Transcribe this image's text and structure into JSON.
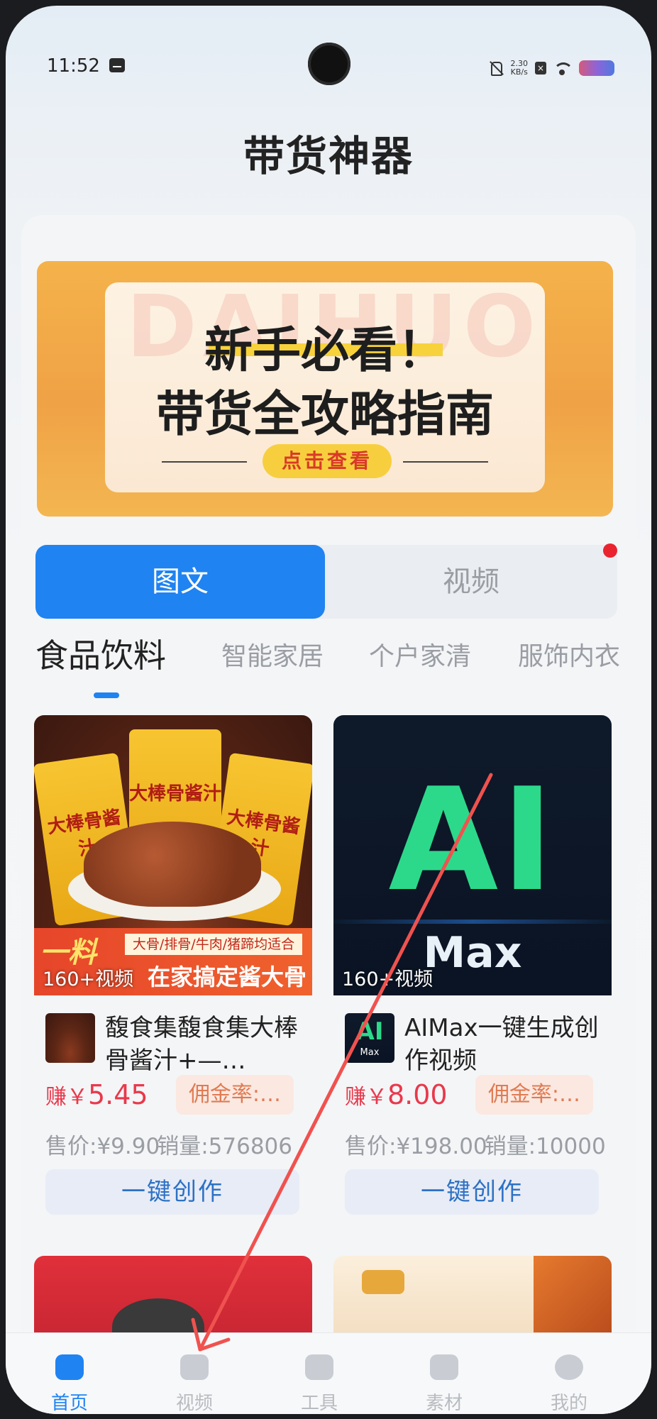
{
  "status_bar": {
    "time": "11:52",
    "speed_value": "2.30",
    "speed_unit": "KB/s",
    "icons": [
      "message-icon",
      "mute-icon",
      "close-badge",
      "wifi-icon",
      "battery-icon"
    ]
  },
  "header": {
    "title": "带货神器"
  },
  "banner": {
    "watermark": "DAIHUO",
    "line1": "新手必看！",
    "line2": "带货全攻略指南",
    "button": "点击查看"
  },
  "segment": {
    "tabs": [
      "图文",
      "视频"
    ],
    "active": "图文"
  },
  "categories": [
    "食品饮料",
    "智能家居",
    "个户家清",
    "服饰内衣"
  ],
  "products": [
    {
      "image_badge": "160+视频",
      "image_text_bag": "大棒骨酱汁",
      "image_text_top": "大骨/排骨/牛肉/猪蹄均适合",
      "image_text_main": "在家搞定酱大骨",
      "image_text_big": "一料",
      "name": "馥食集馥食集大棒骨酱汁+—…",
      "earn_label": "赚￥",
      "earn_value": "5.45",
      "commission": "佣金率:…",
      "price": "售价:¥9.90",
      "sales": "销量:576806",
      "action": "一键创作"
    },
    {
      "image_badge": "160+视频",
      "image_text_ai": "AI",
      "image_text_max": "Max",
      "name": "AIMax一键生成创作视频",
      "earn_label": "赚￥",
      "earn_value": "8.00",
      "commission": "佣金率:…",
      "price": "售价:¥198.00",
      "sales": "销量:10000",
      "action": "一键创作"
    }
  ],
  "tabbar": {
    "items": [
      "首页",
      "视频",
      "工具",
      "素材",
      "我的"
    ],
    "active": "首页"
  },
  "colors": {
    "primary": "#1f83f2",
    "earn": "#e8394b",
    "annotation_arrow": "#f0524f"
  }
}
